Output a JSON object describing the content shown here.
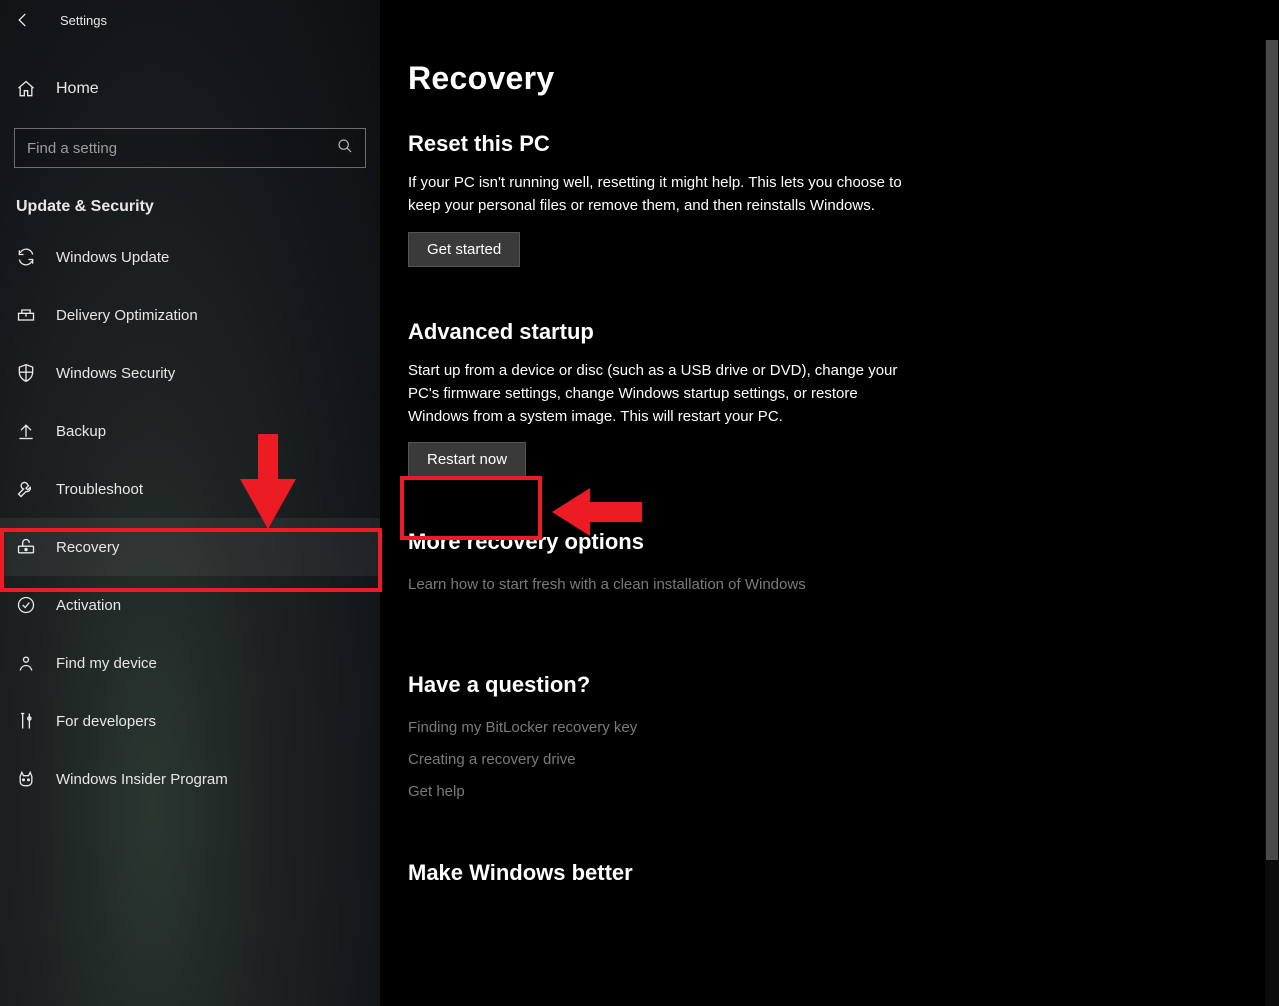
{
  "window": {
    "title": "Settings"
  },
  "sidebar": {
    "home_label": "Home",
    "search_placeholder": "Find a setting",
    "section_label": "Update & Security",
    "items": [
      {
        "label": "Windows Update"
      },
      {
        "label": "Delivery Optimization"
      },
      {
        "label": "Windows Security"
      },
      {
        "label": "Backup"
      },
      {
        "label": "Troubleshoot"
      },
      {
        "label": "Recovery"
      },
      {
        "label": "Activation"
      },
      {
        "label": "Find my device"
      },
      {
        "label": "For developers"
      },
      {
        "label": "Windows Insider Program"
      }
    ]
  },
  "page": {
    "title": "Recovery",
    "reset": {
      "heading": "Reset this PC",
      "desc": "If your PC isn't running well, resetting it might help. This lets you choose to keep your personal files or remove them, and then reinstalls Windows.",
      "button": "Get started"
    },
    "advanced": {
      "heading": "Advanced startup",
      "desc": "Start up from a device or disc (such as a USB drive or DVD), change your PC's firmware settings, change Windows startup settings, or restore Windows from a system image. This will restart your PC.",
      "button": "Restart now"
    },
    "more": {
      "heading": "More recovery options",
      "link": "Learn how to start fresh with a clean installation of Windows"
    },
    "question": {
      "heading": "Have a question?",
      "links": [
        "Finding my BitLocker recovery key",
        "Creating a recovery drive",
        "Get help"
      ]
    },
    "better": {
      "heading": "Make Windows better"
    }
  },
  "annotations": {
    "highlight_color": "#ed1c24"
  }
}
